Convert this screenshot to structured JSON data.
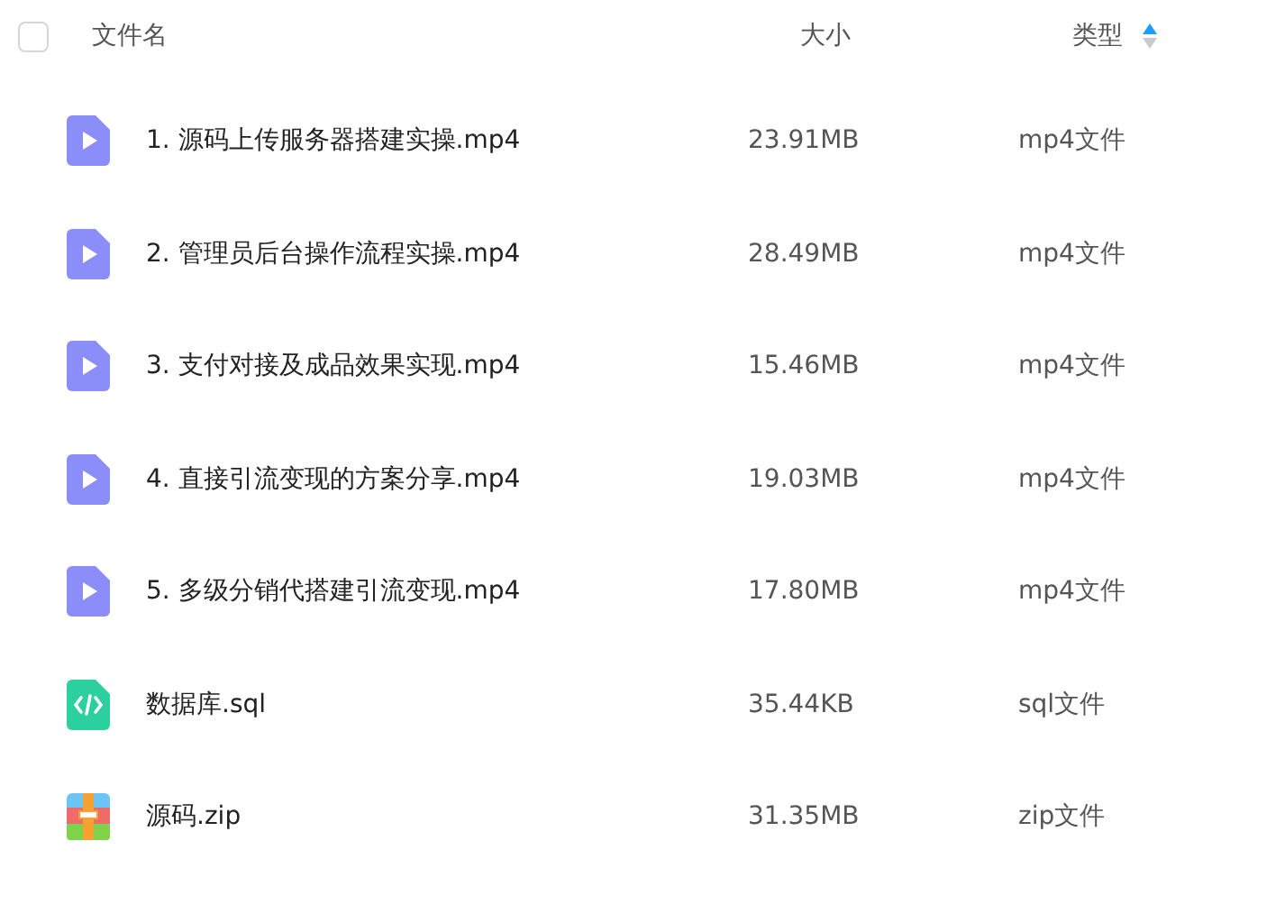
{
  "header": {
    "select_all": {
      "checked": false
    },
    "columns": [
      {
        "label": "文件名",
        "sorted": false
      },
      {
        "label": "大小",
        "sorted": false
      },
      {
        "label": "类型",
        "sorted": true,
        "ascending": true
      }
    ]
  },
  "files": [
    {
      "kind": "video",
      "name": "1. 源码上传服务器搭建实操.mp4",
      "size": "23.91MB",
      "type": "mp4文件"
    },
    {
      "kind": "video",
      "name": "2. 管理员后台操作流程实操.mp4",
      "size": "28.49MB",
      "type": "mp4文件"
    },
    {
      "kind": "video",
      "name": "3. 支付对接及成品效果实现.mp4",
      "size": "15.46MB",
      "type": "mp4文件"
    },
    {
      "kind": "video",
      "name": "4. 直接引流变现的方案分享.mp4",
      "size": "19.03MB",
      "type": "mp4文件"
    },
    {
      "kind": "video",
      "name": "5. 多级分销代搭建引流变现.mp4",
      "size": "17.80MB",
      "type": "mp4文件"
    },
    {
      "kind": "code",
      "name": "数据库.sql",
      "size": "35.44KB",
      "type": "sql文件"
    },
    {
      "kind": "archive",
      "name": "源码.zip",
      "size": "31.35MB",
      "type": "zip文件"
    }
  ]
}
